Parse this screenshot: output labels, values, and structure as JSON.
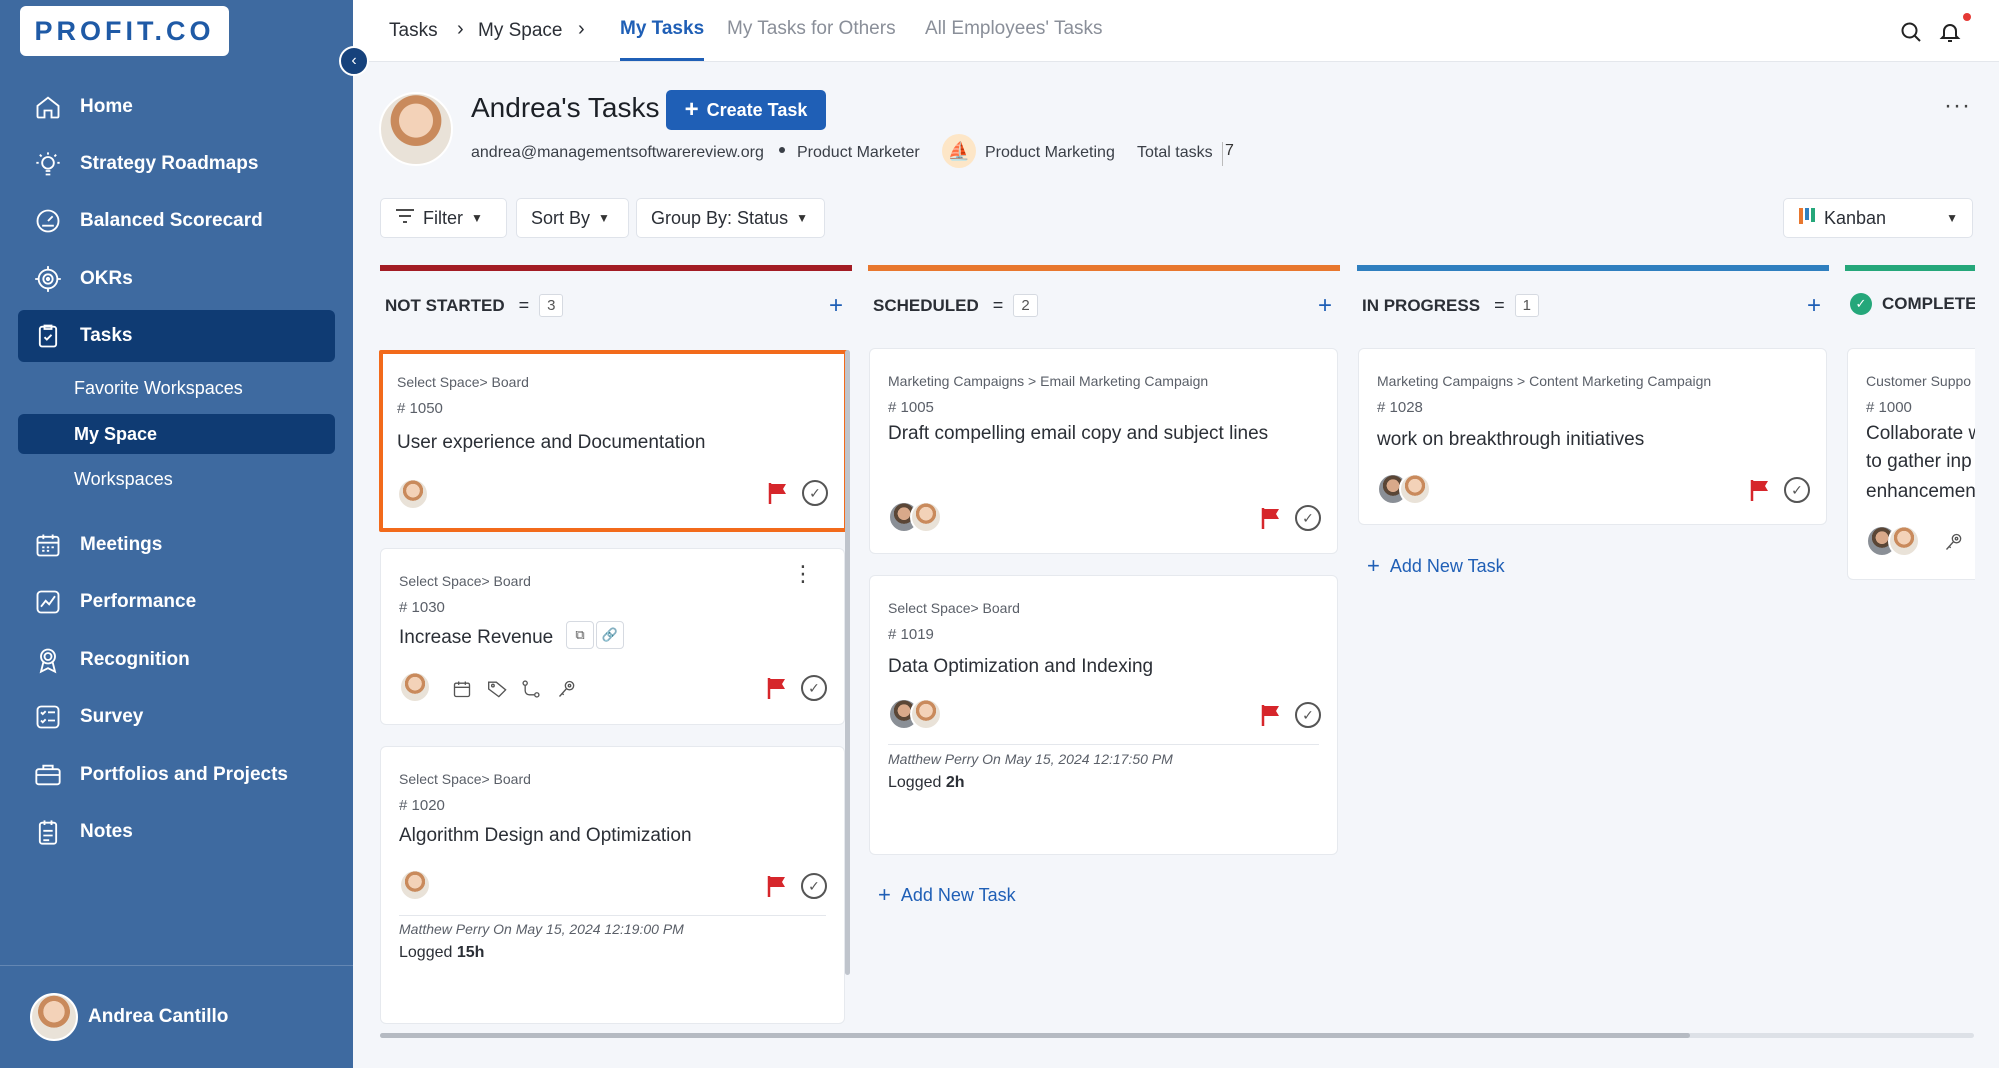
{
  "sidebar": {
    "logo_text": "PROFIT.CO",
    "items": [
      {
        "label": "Home",
        "icon": "home-icon"
      },
      {
        "label": "Strategy Roadmaps",
        "icon": "lightbulb-icon"
      },
      {
        "label": "Balanced Scorecard",
        "icon": "gauge-icon"
      },
      {
        "label": "OKRs",
        "icon": "target-icon"
      },
      {
        "label": "Tasks",
        "icon": "clipboard-check-icon"
      },
      {
        "label": "Meetings",
        "icon": "calendar-icon"
      },
      {
        "label": "Performance",
        "icon": "chart-line-icon"
      },
      {
        "label": "Recognition",
        "icon": "badge-icon"
      },
      {
        "label": "Survey",
        "icon": "survey-icon"
      },
      {
        "label": "Portfolios and Projects",
        "icon": "briefcase-icon"
      },
      {
        "label": "Notes",
        "icon": "notes-icon"
      }
    ],
    "sub_items": [
      "Favorite Workspaces",
      "My Space",
      "Workspaces"
    ],
    "user_name": "Andrea Cantillo"
  },
  "topbar": {
    "breadcrumb": [
      "Tasks",
      "My Space"
    ],
    "tabs": [
      "My Tasks",
      "My Tasks for Others",
      "All Employees' Tasks"
    ]
  },
  "header": {
    "title": "Andrea's Tasks",
    "create_label": "Create Task",
    "email": "andrea@managementsoftwarereview.org",
    "role": "Product Marketer",
    "team": "Product Marketing",
    "total_label": "Total tasks",
    "total_count": "7"
  },
  "toolbar": {
    "filter": "Filter",
    "sort": "Sort By",
    "group": "Group By: Status",
    "view": "Kanban"
  },
  "columns": [
    {
      "title": "NOT STARTED",
      "count": "3",
      "color": "#a31c24"
    },
    {
      "title": "SCHEDULED",
      "count": "2",
      "color": "#e8772e"
    },
    {
      "title": "IN PROGRESS",
      "count": "1",
      "color": "#2f7fbf"
    },
    {
      "title": "COMPLETE",
      "color": "#25a77a"
    }
  ],
  "cards": {
    "c1050": {
      "path": "Select Space> Board",
      "num": "# 1050",
      "title": "User experience and Documentation"
    },
    "c1030": {
      "path": "Select Space> Board",
      "num": "# 1030",
      "title": "Increase Revenue"
    },
    "c1020": {
      "path": "Select Space> Board",
      "num": "# 1020",
      "title": "Algorithm Design and Optimization",
      "log_by": "Matthew Perry On May 15, 2024 12:19:00 PM",
      "log_label": "Logged",
      "log_value": "15h"
    },
    "c1005": {
      "path": "Marketing Campaigns > Email Marketing Campaign",
      "num": "# 1005",
      "title": "Draft compelling email copy and subject lines"
    },
    "c1019": {
      "path": "Select Space> Board",
      "num": "# 1019",
      "title": "Data Optimization and Indexing",
      "log_by": "Matthew Perry On May 15, 2024 12:17:50 PM",
      "log_label": "Logged",
      "log_value": "2h"
    },
    "c1028": {
      "path": "Marketing Campaigns > Content Marketing Campaign",
      "num": "# 1028",
      "title": "work on breakthrough initiatives"
    },
    "c1000": {
      "path": "Customer Suppo",
      "num": "# 1000",
      "line1": "Collaborate w",
      "line2": "to gather inp",
      "line3": "enhancemen"
    }
  },
  "add_task_label": "Add New Task"
}
